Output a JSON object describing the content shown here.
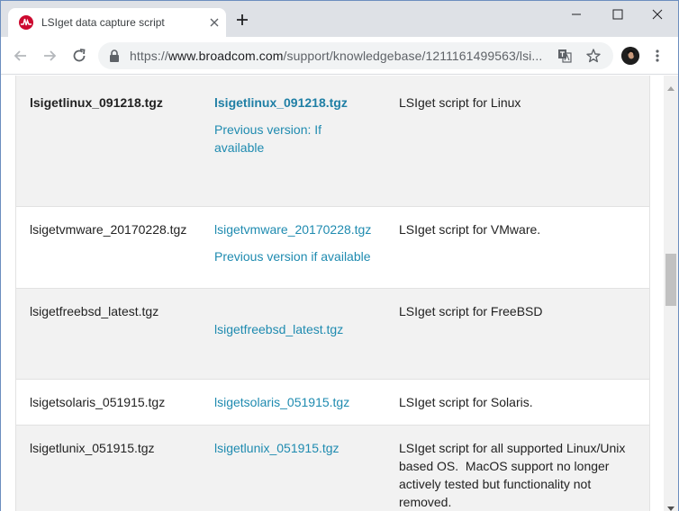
{
  "browser": {
    "tab_title": "LSIget data capture script",
    "url_scheme": "https://",
    "url_host": "www.broadcom.com",
    "url_path": "/support/knowledgebase/1211161499563/lsi..."
  },
  "table": {
    "rows": [
      {
        "file": "lsigetlinux_091218.tgz",
        "link": "lsigetlinux_091218.tgz",
        "link2": "Previous version: If available",
        "description": "LSIget script for Linux"
      },
      {
        "file": "lsigetvmware_20170228.tgz",
        "link": "lsigetvmware_20170228.tgz",
        "link2": "Previous version if available",
        "description": "LSIget script for VMware."
      },
      {
        "file": "lsigetfreebsd_latest.tgz",
        "link": "lsigetfreebsd_latest.tgz",
        "description": "LSIget script for FreeBSD"
      },
      {
        "file": "lsigetsolaris_051915.tgz",
        "link": "lsigetsolaris_051915.tgz",
        "description": "LSIget script for Solaris."
      },
      {
        "file": "lsigetlunix_051915.tgz",
        "link": "lsigetlunix_051915.tgz",
        "description": "LSIget script for all supported Linux/Unix based OS.  MacOS support no longer actively tested but functionality not removed."
      }
    ]
  },
  "colors": {
    "link": "#1f8bb0",
    "row_shade": "#f2f2f2",
    "brand": "#cc092f"
  }
}
